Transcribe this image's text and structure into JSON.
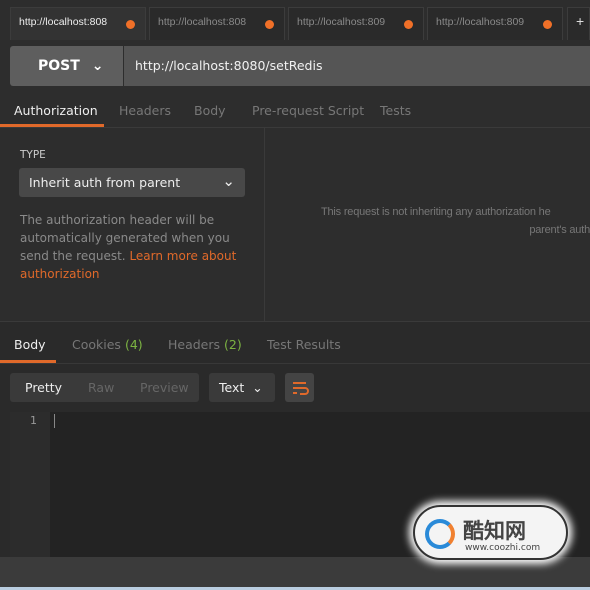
{
  "tabs": [
    {
      "label": "http://localhost:808"
    },
    {
      "label": "http://localhost:808"
    },
    {
      "label": "http://localhost:809"
    },
    {
      "label": "http://localhost:809"
    }
  ],
  "new_tab": "+",
  "request": {
    "method": "POST",
    "url": "http://localhost:8080/setRedis"
  },
  "req_tabs": [
    "Authorization",
    "Headers",
    "Body",
    "Pre-request Script",
    "Tests"
  ],
  "auth": {
    "type_label": "TYPE",
    "type_value": "Inherit auth from parent",
    "desc": "The authorization header will be automatically generated when you send the request. ",
    "link": "Learn more about authorization",
    "right_line1": "This request is not inheriting any authorization he",
    "right_line2": "parent's auth"
  },
  "resp_tabs": {
    "body": "Body",
    "cookies": "Cookies",
    "cookies_count": "(4)",
    "headers": "Headers",
    "headers_count": "(2)",
    "tests": "Test Results"
  },
  "toolbar": {
    "pretty": "Pretty",
    "raw": "Raw",
    "preview": "Preview",
    "format": "Text"
  },
  "editor": {
    "line": "1"
  },
  "watermark": {
    "name": "酷知网",
    "url": "www.coozhi.com"
  },
  "colors": {
    "accent": "#e0692a",
    "count": "#7cb342"
  }
}
